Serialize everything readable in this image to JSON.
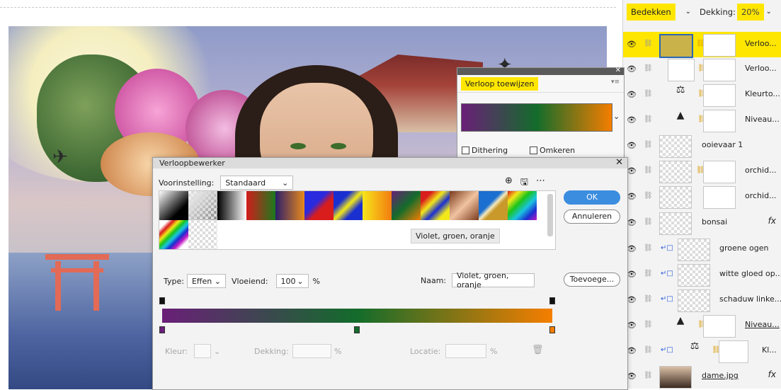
{
  "layers_panel": {
    "blend_mode": "Bedekken",
    "opacity_label": "Dekking:",
    "opacity_value": "20%",
    "layers": [
      {
        "name": "Verloo...",
        "selected": true,
        "fx": false
      },
      {
        "name": "Verloo...",
        "fx": false
      },
      {
        "name": "Kleurto...",
        "fx": false
      },
      {
        "name": "Niveau...",
        "fx": false
      },
      {
        "name": "ooievaar 1",
        "fx": false
      },
      {
        "name": "orchid...",
        "fx": false
      },
      {
        "name": "orchid...",
        "fx": false
      },
      {
        "name": "bonsai",
        "fx": true
      },
      {
        "name": "groene ogen",
        "fx": false
      },
      {
        "name": "witte gloed op...",
        "fx": false
      },
      {
        "name": "schaduw linke...",
        "fx": false
      },
      {
        "name": "Niveau...",
        "fx": false
      },
      {
        "name": "Kl...",
        "fx": false
      },
      {
        "name": "dame.jpg",
        "fx": true
      }
    ],
    "fx_label": "fx"
  },
  "assign_panel": {
    "title": "Verloop toewijzen",
    "dithering": "Dithering",
    "reverse": "Omkeren"
  },
  "editor": {
    "title": "Verloopbewerker",
    "preset_label": "Voorinstelling:",
    "preset_value": "Standaard",
    "ok": "OK",
    "cancel": "Annuleren",
    "add": "Toevoege...",
    "tooltip": "Violet, groen, oranje",
    "type_label": "Type:",
    "type_value": "Effen",
    "smooth_label": "Vloeiend:",
    "smooth_value": "100",
    "percent": "%",
    "name_label": "Naam:",
    "name_value": "Violet, groen, oranje",
    "color_label": "Kleur:",
    "opacity_label": "Dekking:",
    "location_label": "Locatie:",
    "colors": {
      "violet": "#6a1f78",
      "green": "#136c2b",
      "orange": "#f57e00",
      "accent": "#3b8ddf",
      "highlight": "#ffe600"
    }
  }
}
